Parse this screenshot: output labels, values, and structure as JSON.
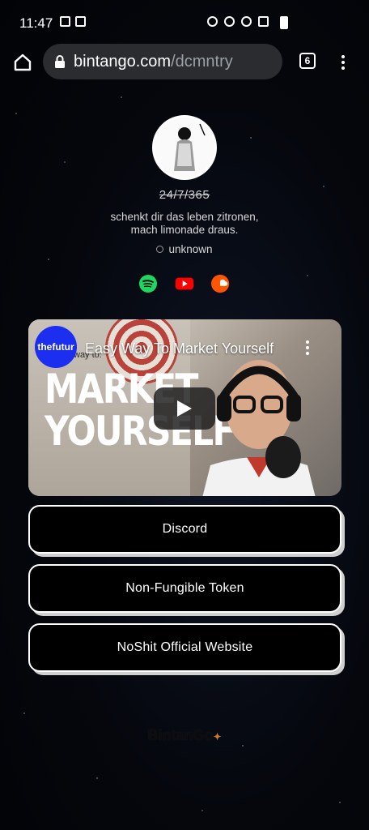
{
  "status_bar": {
    "time": "11:47"
  },
  "browser": {
    "url_host": "bintango.com",
    "url_path": "/dcmntry",
    "tab_count": "6"
  },
  "profile": {
    "name": "24/7/365",
    "bio_line1": "schenkt dir das leben zitronen,",
    "bio_line2": "mach limonade draus.",
    "location": "unknown",
    "socials": [
      "spotify-icon",
      "youtube-icon",
      "soundcloud-icon"
    ]
  },
  "video": {
    "channel_badge": "thefutur",
    "title": "Easy Way To Market Yourself",
    "thumb_small": "way to:",
    "thumb_line1": "MARKET",
    "thumb_line2": "YOURSELF"
  },
  "links": [
    {
      "label": "Discord"
    },
    {
      "label": "Non-Fungible Token"
    },
    {
      "label": "NoShit Official Website"
    }
  ],
  "footer": {
    "brand": "BintanGo"
  },
  "colors": {
    "spotify": "#1ed760",
    "youtube": "#ff0000",
    "soundcloud": "#ff5500",
    "channel_badge": "#1c2ff0",
    "url_bar": "#2a2c30"
  }
}
